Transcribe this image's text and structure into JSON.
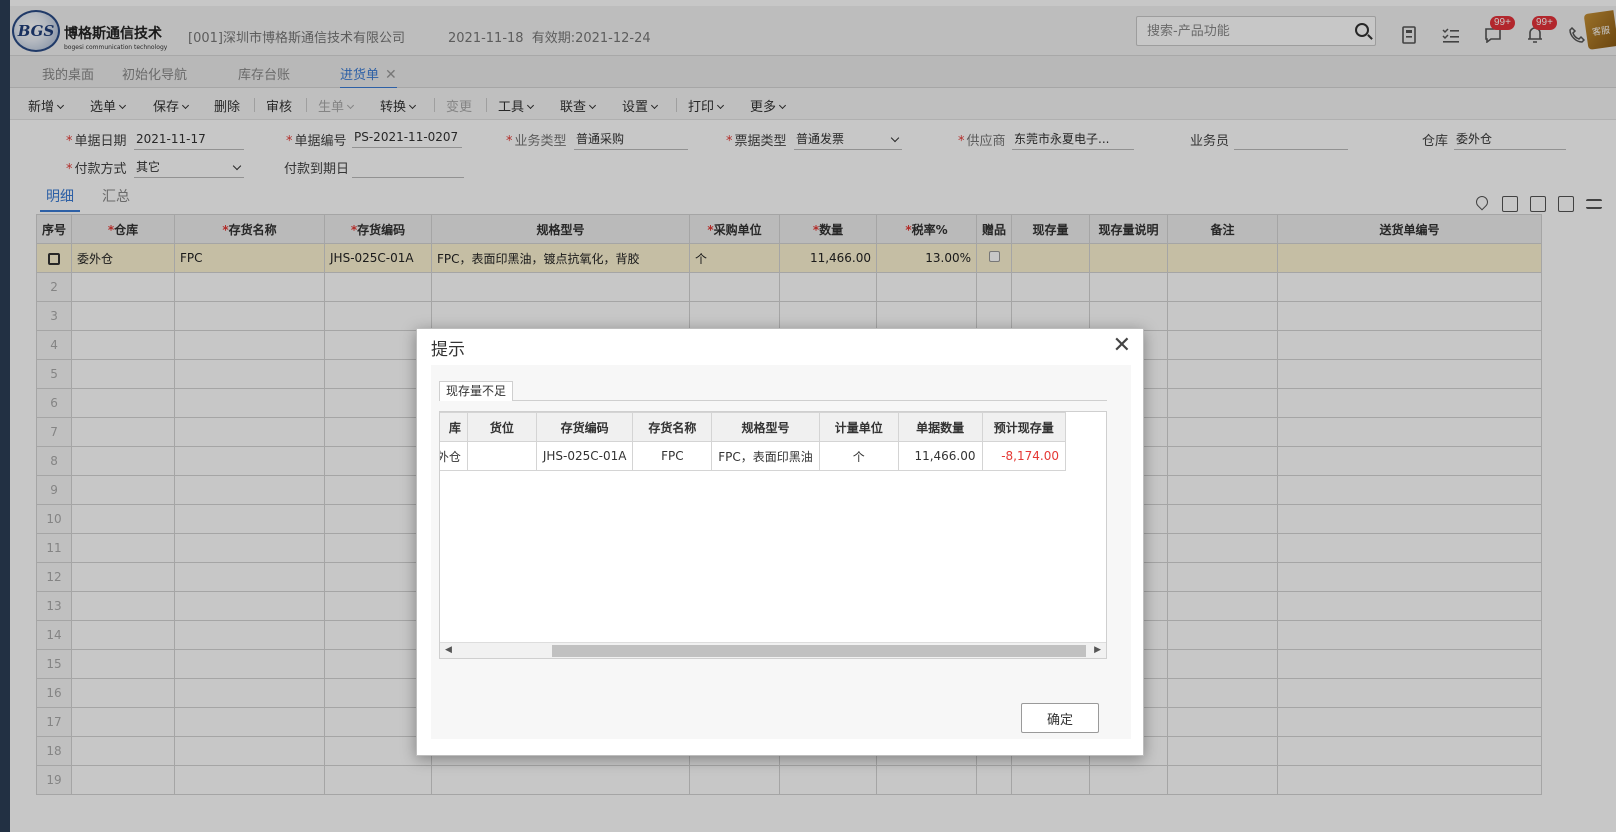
{
  "header": {
    "logo_mark": "BGS",
    "logo_name": "博格斯通信技术",
    "logo_subtitle": "bogesi communication technology",
    "company": "[001]深圳市博格斯通信技术有限公司",
    "date": "2021-11-18",
    "validity": "有效期:2021-12-24",
    "search_placeholder": "搜索-产品功能",
    "badge_messages": "99+",
    "badge_notices": "99+",
    "stamp_text": "客服"
  },
  "tabs": [
    {
      "label": "我的桌面"
    },
    {
      "label": "初始化导航"
    },
    {
      "label": "库存台账"
    },
    {
      "label": "进货单"
    }
  ],
  "toolbar": {
    "new": "新增",
    "select": "选单",
    "save": "保存",
    "delete": "删除",
    "audit": "审核",
    "generate": "生单",
    "convert": "转换",
    "change": "变更",
    "tools": "工具",
    "linked": "联查",
    "settings": "设置",
    "print": "打印",
    "more": "更多"
  },
  "form": {
    "doc_date_label": "单据日期",
    "doc_date": "2021-11-17",
    "doc_no_label": "单据编号",
    "doc_no": "PS-2021-11-0207",
    "biz_type_label": "业务类型",
    "biz_type": "普通采购",
    "invoice_type_label": "票据类型",
    "invoice_type": "普通发票",
    "supplier_label": "供应商",
    "supplier": "东莞市永夏电子...",
    "salesman_label": "业务员",
    "salesman": "",
    "warehouse_label": "仓库",
    "warehouse": "委外仓",
    "payment_label": "付款方式",
    "payment": "其它",
    "due_label": "付款到期日",
    "due": ""
  },
  "subtabs": [
    "明细",
    "汇总"
  ],
  "detail_table": {
    "columns": [
      "序号",
      "仓库",
      "存货名称",
      "存货编码",
      "规格型号",
      "采购单位",
      "数量",
      "税率%",
      "赠品",
      "现存量",
      "现存量说明",
      "备注",
      "送货单编号"
    ],
    "required": [
      false,
      true,
      true,
      true,
      false,
      true,
      true,
      true,
      false,
      false,
      false,
      false,
      false
    ],
    "row": {
      "warehouse": "委外仓",
      "name": "FPC",
      "code": "JHS-025C-01A",
      "spec": "FPC，表面印黑油，镀点抗氧化，背胶",
      "unit": "个",
      "qty": "11,466.00",
      "tax": "13.00%"
    },
    "empty_rows": [
      "2",
      "3",
      "4",
      "5",
      "6",
      "7",
      "8",
      "9",
      "10",
      "11",
      "12",
      "13",
      "14",
      "15",
      "16",
      "17",
      "18",
      "19"
    ]
  },
  "dialog": {
    "title": "提示",
    "tab": "现存量不足",
    "columns": [
      "库",
      "货位",
      "存货编码",
      "存货名称",
      "规格型号",
      "计量单位",
      "单据数量",
      "预计现存量"
    ],
    "row": {
      "warehouse": "委外仓",
      "location": "",
      "code": "JHS-025C-01A",
      "name": "FPC",
      "spec": "FPC，表面印黑油",
      "unit": "个",
      "qty": "11,466.00",
      "projected": "-8,174.00"
    },
    "ok": "确定"
  }
}
